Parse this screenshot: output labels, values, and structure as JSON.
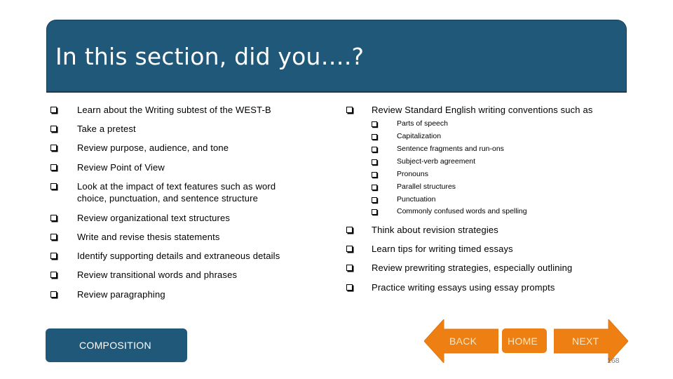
{
  "header": {
    "title": "In this section, did you….?"
  },
  "left_column": {
    "items": [
      {
        "label": "Learn about the Writing subtest of the WEST-B",
        "checked": false
      },
      {
        "label": "Take a pretest",
        "checked": false
      },
      {
        "label": "Review purpose, audience, and tone",
        "checked": false
      },
      {
        "label": "Review Point of View",
        "checked": false
      },
      {
        "label": "Look at the impact of text features such as word",
        "label_line2": "choice, punctuation, and sentence structure",
        "checked": false
      },
      {
        "label": "Review organizational text structures",
        "checked": false
      },
      {
        "label": "Write and revise thesis statements",
        "checked": false
      },
      {
        "label": "Identify supporting details and extraneous details",
        "checked": false
      },
      {
        "label": "Review transitional words and phrases",
        "checked": false
      },
      {
        "label": "Review paragraphing",
        "checked": false
      }
    ]
  },
  "right_column": {
    "items": [
      {
        "label": "Review Standard English writing conventions such as",
        "checked": false,
        "subitems": [
          {
            "label": "Parts of speech",
            "checked": false
          },
          {
            "label": "Capitalization",
            "checked": false
          },
          {
            "label": "Sentence fragments and run-ons",
            "checked": false
          },
          {
            "label": "Subject-verb agreement",
            "checked": false
          },
          {
            "label": "Pronouns",
            "checked": false
          },
          {
            "label": "Parallel structures",
            "checked": false
          },
          {
            "label": "Punctuation",
            "checked": false
          },
          {
            "label": "Commonly confused words and spelling",
            "checked": false
          }
        ]
      },
      {
        "label": "Think about revision strategies",
        "checked": false
      },
      {
        "label": "Learn tips for writing timed essays",
        "checked": false
      },
      {
        "label": "Review prewriting strategies, especially outlining",
        "checked": false
      },
      {
        "label": "Practice writing essays using essay prompts",
        "checked": false
      }
    ]
  },
  "footer": {
    "composition_label": "COMPOSITION",
    "back_label": "BACK",
    "home_label": "HOME",
    "next_label": "NEXT",
    "page_number": "168"
  },
  "colors": {
    "header_bg": "#1f5879",
    "nav_orange": "#ee7f12",
    "nav_text": "#fbe7c6"
  },
  "icons": {
    "checkbox": "empty-checkbox-square",
    "back": "left-arrow",
    "next": "right-arrow"
  }
}
